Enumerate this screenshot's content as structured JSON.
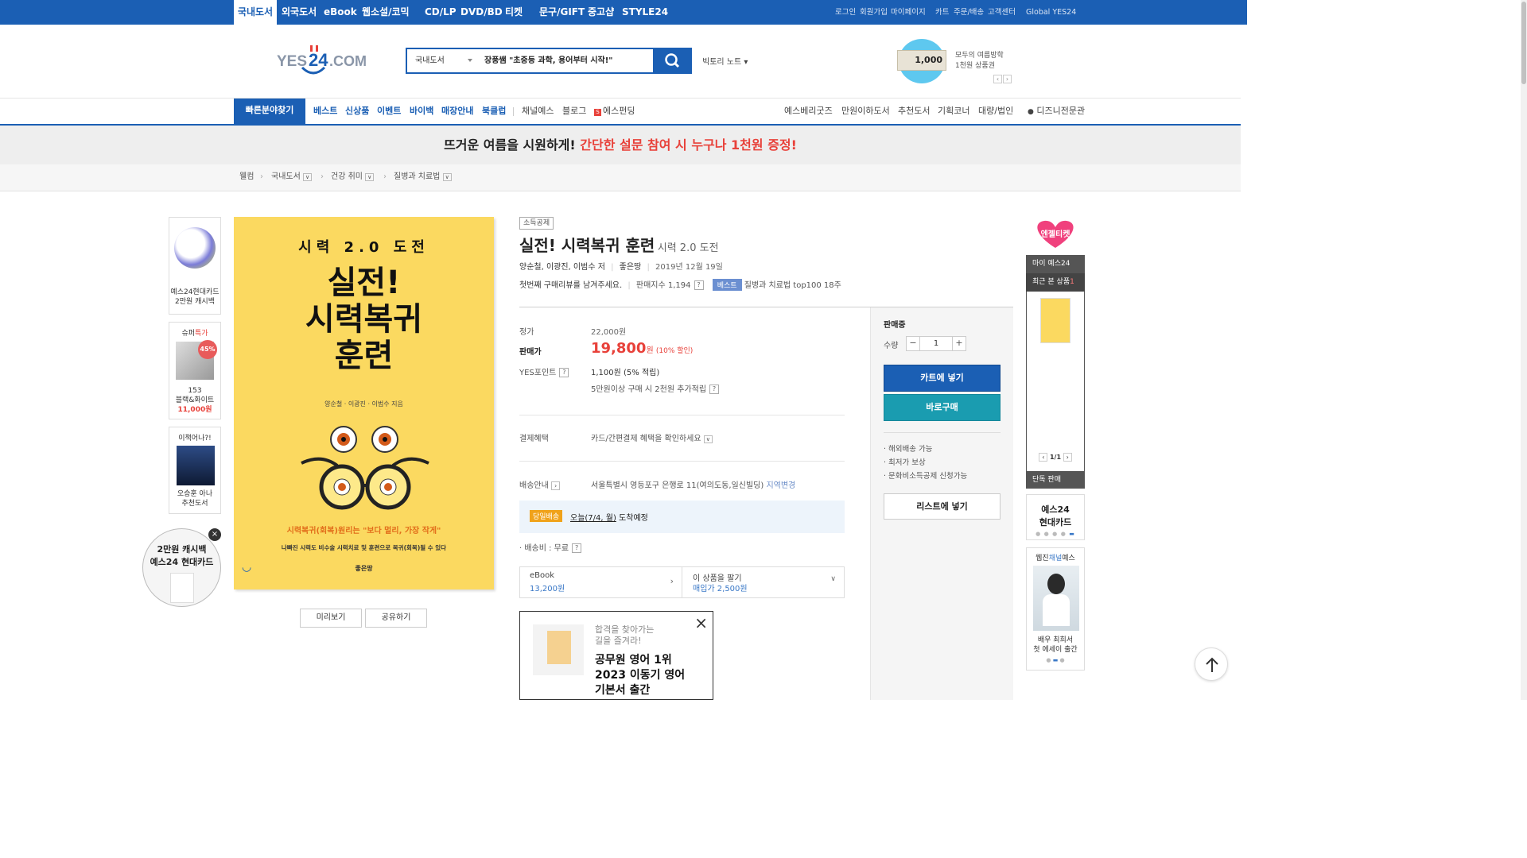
{
  "gnb_top": {
    "tabs": [
      "국내도서",
      "외국도서",
      "eBook",
      "웹소설/코믹",
      "CD/LP",
      "DVD/BD",
      "티켓",
      "문구/GIFT",
      "중고샵",
      "STYLE24"
    ],
    "util": [
      "로그인",
      "회원가입",
      "마이페이지",
      "카트",
      "주문/배송",
      "고객센터",
      "Global YES24"
    ]
  },
  "logo": {
    "text": "YES24.COM"
  },
  "search": {
    "category": "국내도서",
    "keyword": "장풍쌤 \"초중등 과학, 용어부터 시작!\"",
    "side_link": "빅토리 노트"
  },
  "promo_top": {
    "amount": "1,000",
    "line1": "모두의 여름방학",
    "line2": "1천원 상품권"
  },
  "gnb": {
    "quick": "빠른분야찾기",
    "main": [
      "베스트",
      "신상품",
      "이벤트",
      "바이백",
      "매장안내",
      "북클럽"
    ],
    "sub": [
      "채널예스",
      "블로그",
      "에스펀딩"
    ],
    "right": [
      "예스베리굿즈",
      "만원이하도서",
      "추천도서",
      "기획코너",
      "대량/법인",
      "디즈니전문관"
    ]
  },
  "banner": {
    "part1": "뜨거운 여름을 시원하게!",
    "part2": "간단한 설문 참여 시 누구나 1천원 증정!"
  },
  "breadcrumb": [
    "웰컴",
    "국내도서",
    "건강 취미",
    "질병과 치료법"
  ],
  "left_ads": {
    "card": {
      "line1": "예스24현대카드",
      "line2": "2만원 캐시백"
    },
    "super": {
      "title1": "슈퍼",
      "title2": "특가",
      "badge": "45%",
      "line1": "153",
      "line2": "블랙&화이트",
      "price": "11,000원"
    },
    "book": {
      "title": "이책어나?!",
      "line1": "오승훈 아나",
      "line2": "추천도서"
    },
    "circle": {
      "line1": "2만원 캐시백",
      "line2": "예스24 현대카드"
    }
  },
  "cover": {
    "top": "시력 2.0 도전",
    "t1": "실전!",
    "t2": "시력복귀",
    "t3": "훈련",
    "authors": "양순철 · 이광진 · 이범수 지음",
    "tag": "시력복귀(회복)원리는 \"보다 멀리, 가장 작게\"",
    "sub": "나빠진 시력도 비수술 시력치료 및 훈련으로 복귀(회복)될 수 있다",
    "publisher": "좋은땅"
  },
  "cover_buttons": {
    "preview": "미리보기",
    "share": "공유하기"
  },
  "product": {
    "badge": "소득공제",
    "title": "실전! 시력복귀 훈련",
    "subtitle": "시력 2.0 도전",
    "authors": "양순철, 이광진, 이범수 저",
    "publisher": "좋은땅",
    "date": "2019년 12월 19일",
    "review": "첫번째 구매리뷰를 남겨주세요.",
    "sales_index": "판매지수 1,194",
    "best_badge": "베스트",
    "best_rank": "질병과 치료법 top100 18주"
  },
  "price": {
    "list_label": "정가",
    "list_value": "22,000원",
    "sale_label": "판매가",
    "sale_value": "19,800",
    "sale_unit": "원",
    "discount": "(10% 할인)",
    "point_label": "YES포인트",
    "point_value": "1,100원 (5% 적립)",
    "extra": "5만원이상 구매 시 2천원 추가적립"
  },
  "payment": {
    "label": "결제혜택",
    "value": "카드/간편결제 혜택을 확인하세요"
  },
  "delivery": {
    "label": "배송안내",
    "address": "서울특별시 영등포구 은행로 11(여의도동,일신빌딩)",
    "change": "지역변경",
    "badge": "당일배송",
    "today": "오늘(7/4, 월)",
    "arrive": "도착예정",
    "fee": "· 배송비 : 무료"
  },
  "formats": {
    "ebook_label": "eBook",
    "ebook_price": "13,200원",
    "sell_label": "이 상품을 팔기",
    "sell_price": "매입가 2,500원"
  },
  "ad_popup": {
    "line1": "합격을 찾아가는",
    "line2": "길을 즐겨라!",
    "h1": "공무원 영어 1위",
    "h2": "2023 이동기 영어",
    "h3": "기본서 출간"
  },
  "buybox": {
    "status": "판매중",
    "qty_label": "수량",
    "qty": "1",
    "cart": "카트에 넣기",
    "buy": "바로구매",
    "notes": [
      "해외배송 가능",
      "최저가 보상",
      "문화비소득공제 신청가능"
    ],
    "wishlist": "리스트에 넣기"
  },
  "right_rail": {
    "angel": "엔젤티켓",
    "my": "마이 예스24",
    "recent": "최근 본 상품",
    "recent_count": "1",
    "pager": "1/1",
    "exclusive": "단독 판매",
    "card1": "예스24",
    "card2": "현대카드",
    "web1": "웹진",
    "web2": "채널",
    "web3": "예스",
    "person1": "배우 최희서",
    "person2": "첫 에세이 출간"
  },
  "colors": {
    "brand": "#1b5fb4",
    "price": "#e8413a",
    "teal": "#1a9cb0"
  }
}
